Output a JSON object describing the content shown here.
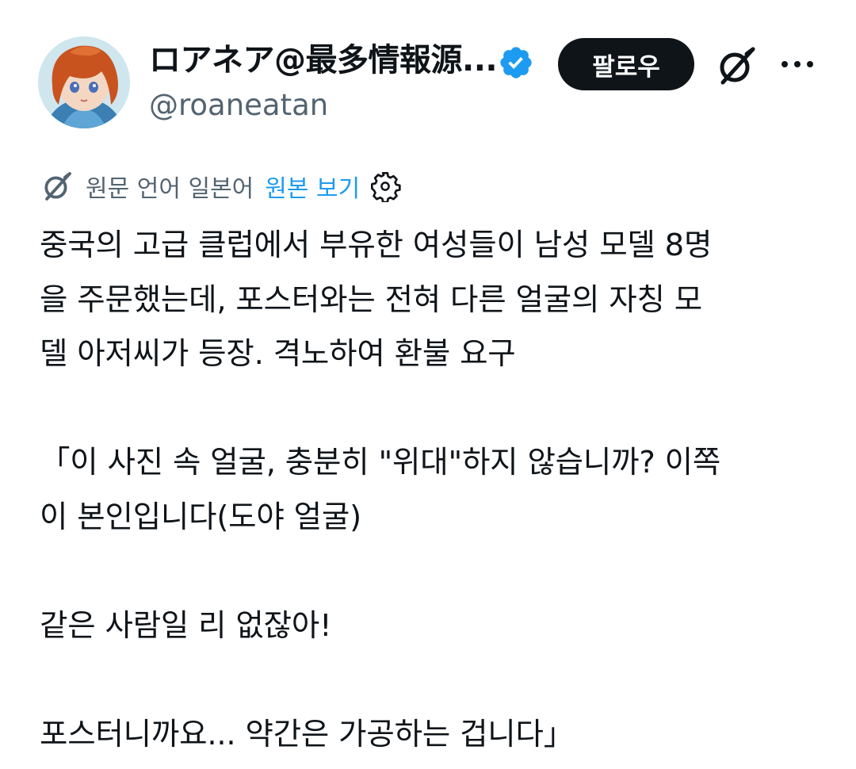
{
  "author": {
    "display_name": "ロアネア@最多情報源...",
    "handle": "@roaneatan",
    "verified_icon": "verified-badge-icon",
    "colors": {
      "verified": "#1d9bf0"
    }
  },
  "actions": {
    "follow_label": "팔로우",
    "grok_icon": "grok-icon",
    "more_icon": "more-dots-icon"
  },
  "translation": {
    "source_language_label": "원문 언어 일본어",
    "show_original_label": "원본 보기",
    "settings_icon": "gear-icon",
    "colors": {
      "link": "#1d9bf0"
    }
  },
  "tweet": {
    "paragraphs": [
      [
        "중국의 고급 클럽에서 부유한 여성들이 남성 모델 8명",
        "을 주문했는데, 포스터와는 전혀 다른 얼굴의 자칭 모",
        "델 아저씨가 등장. 격노하여 환불 요구"
      ],
      [
        "「이 사진 속 얼굴, 충분히 \"위대\"하지 않습니까? 이쪽",
        "이 본인입니다(도야 얼굴)"
      ],
      [
        "같은 사람일 리 없잖아!"
      ],
      [
        "포스터니까요... 약간은 가공하는 겁니다」"
      ]
    ]
  },
  "colors": {
    "text": "#0f1419",
    "secondary": "#536471",
    "follow_bg": "#0f1419",
    "background": "#ffffff"
  }
}
